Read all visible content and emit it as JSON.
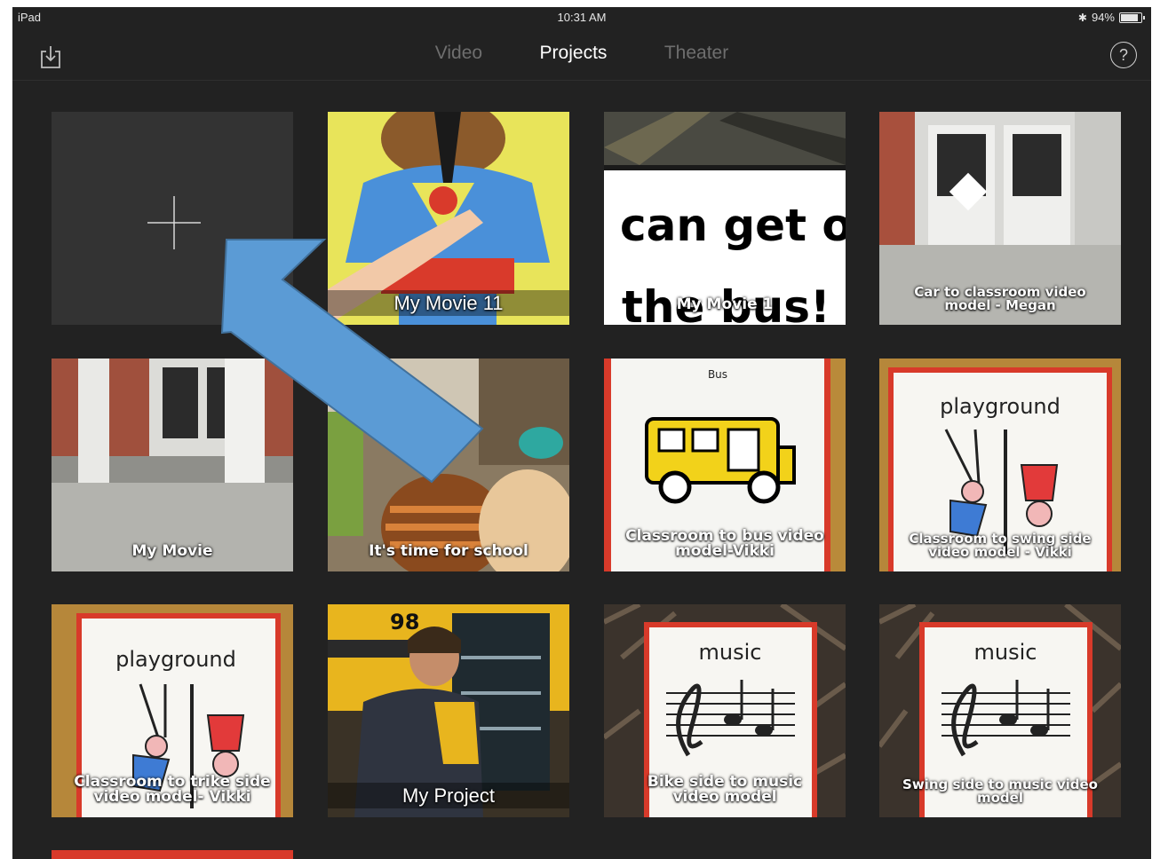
{
  "status_bar": {
    "device": "iPad",
    "time": "10:31 AM",
    "battery": "94%",
    "battery_level": 0.94
  },
  "nav": {
    "tabs": [
      {
        "label": "Video",
        "active": false
      },
      {
        "label": "Projects",
        "active": true
      },
      {
        "label": "Theater",
        "active": false
      }
    ],
    "help_label": "?"
  },
  "projects": [
    {
      "title": "My Movie 11"
    },
    {
      "title": "My Movie 1",
      "overlay_text_line1": "can get o",
      "overlay_text_line2": "the bus!"
    },
    {
      "title": "Car to classroom video model - Megan"
    },
    {
      "title": "My Movie"
    },
    {
      "title": "It's time for school"
    },
    {
      "title": "Classroom to bus video model-Vikki",
      "sign_text": "Bus"
    },
    {
      "title": "Classroom to swing side video model - Vikki",
      "sign_text": "playground"
    },
    {
      "title": "Classroom to trike side video model- Vikki",
      "sign_text": "playground"
    },
    {
      "title": "My Project",
      "bus_number": "98"
    },
    {
      "title": "Bike side to music video model",
      "sign_text": "music"
    },
    {
      "title": "Swing side to music video model",
      "sign_text": "music"
    }
  ],
  "colors": {
    "background": "#222222",
    "tile_new": "#333333",
    "annotation_arrow": "#5b9bd5"
  }
}
